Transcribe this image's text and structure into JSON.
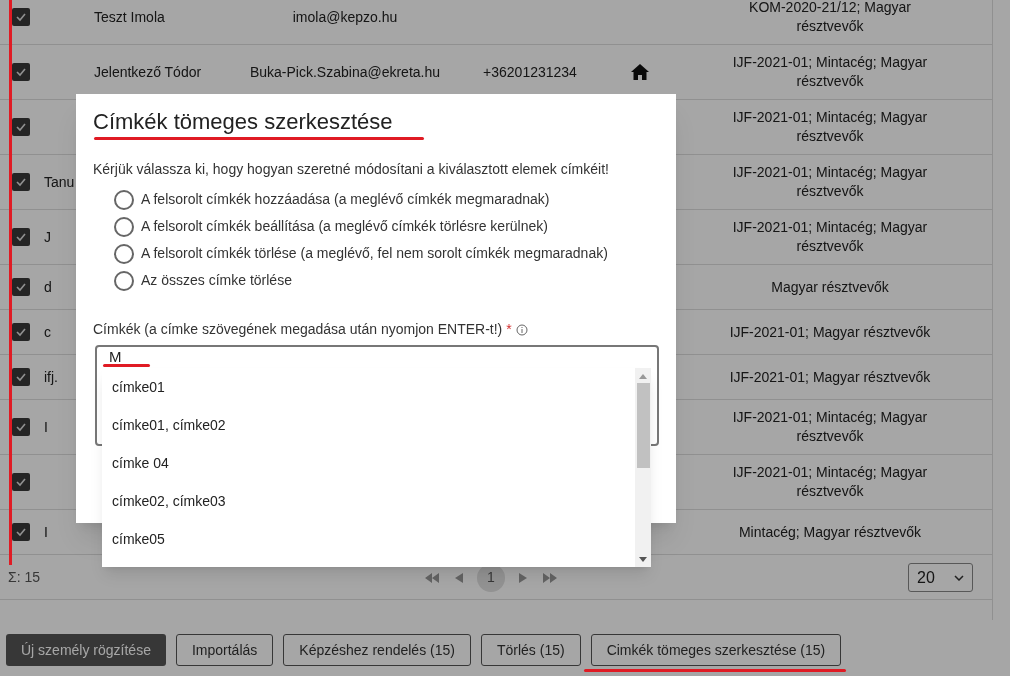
{
  "table": {
    "rows": [
      {
        "checked": true,
        "name": "Teszt Imola",
        "email": "imola@kepzo.hu",
        "phone": "",
        "home": false,
        "tags": "KOM-2020-21/12; Magyar résztvevők"
      },
      {
        "checked": true,
        "name": "Jelentkező Tódor",
        "email": "Buka-Pick.Szabina@ekreta.hu",
        "phone": "+36201231234",
        "home": true,
        "tags": "IJF-2021-01; Mintacég; Magyar résztvevők"
      },
      {
        "checked": true,
        "name": "",
        "email": "",
        "phone": "",
        "home": false,
        "tags": "IJF-2021-01; Mintacég; Magyar résztvevők"
      },
      {
        "checked": true,
        "name": "Tanu",
        "email": "",
        "phone": "",
        "home": false,
        "tags": "IJF-2021-01; Mintacég; Magyar résztvevők"
      },
      {
        "checked": true,
        "name": "J",
        "email": "",
        "phone": "",
        "home": false,
        "tags": "IJF-2021-01; Mintacég; Magyar résztvevők"
      },
      {
        "checked": true,
        "name": "d",
        "email": "",
        "phone": "",
        "home": false,
        "tags": "Magyar résztvevők"
      },
      {
        "checked": true,
        "name": "c",
        "email": "",
        "phone": "",
        "home": false,
        "tags": "IJF-2021-01; Magyar résztvevők"
      },
      {
        "checked": true,
        "name": "ifj.",
        "email": "",
        "phone": "",
        "home": false,
        "tags": "IJF-2021-01; Magyar résztvevők"
      },
      {
        "checked": true,
        "name": "I",
        "email": "",
        "phone": "",
        "home": false,
        "tags": "IJF-2021-01; Mintacég; Magyar résztvevők"
      },
      {
        "checked": true,
        "name": "",
        "email": "",
        "phone": "",
        "home": false,
        "tags": "IJF-2021-01; Mintacég; Magyar résztvevők"
      },
      {
        "checked": true,
        "name": "I",
        "email": "",
        "phone": "",
        "home": false,
        "tags": "Mintacég; Magyar résztvevők"
      }
    ]
  },
  "footer": {
    "total": "Σ: 15",
    "page": "1",
    "page_size": "20"
  },
  "actions": [
    {
      "label": "Új személy rögzítése",
      "kind": "primary"
    },
    {
      "label": "Importálás",
      "kind": "outline"
    },
    {
      "label": "Képzéshez rendelés (15)",
      "kind": "outline"
    },
    {
      "label": "Törlés (15)",
      "kind": "outline"
    },
    {
      "label": "Cimkék tömeges szerkesztése (15)",
      "kind": "outline"
    }
  ],
  "dialog": {
    "title": "Címkék tömeges szerkesztése",
    "prompt": "Kérjük válassza ki, hogy hogyan szeretné módosítani a kiválasztott elemek címkéit!",
    "options": [
      {
        "label": "A felsorolt címkék hozzáadása (a meglévő címkék megmaradnak)",
        "selected": false
      },
      {
        "label": "A felsorolt címkék beállítása (a meglévő címkék törlésre kerülnek)",
        "selected": false
      },
      {
        "label": "A felsorolt címkék törlése (a meglévő, fel nem sorolt címkék megmaradnak)",
        "selected": false
      },
      {
        "label": "Az összes címke törlése",
        "selected": false
      }
    ],
    "tags_label": "Címkék (a címke szövegének megadása után nyomjon ENTER-t!)",
    "required_mark": "*",
    "tags_value": "M",
    "suggestions": [
      "címke01",
      "címke01, címke02",
      "címke 04",
      "címke02, címke03",
      "címke05"
    ]
  }
}
